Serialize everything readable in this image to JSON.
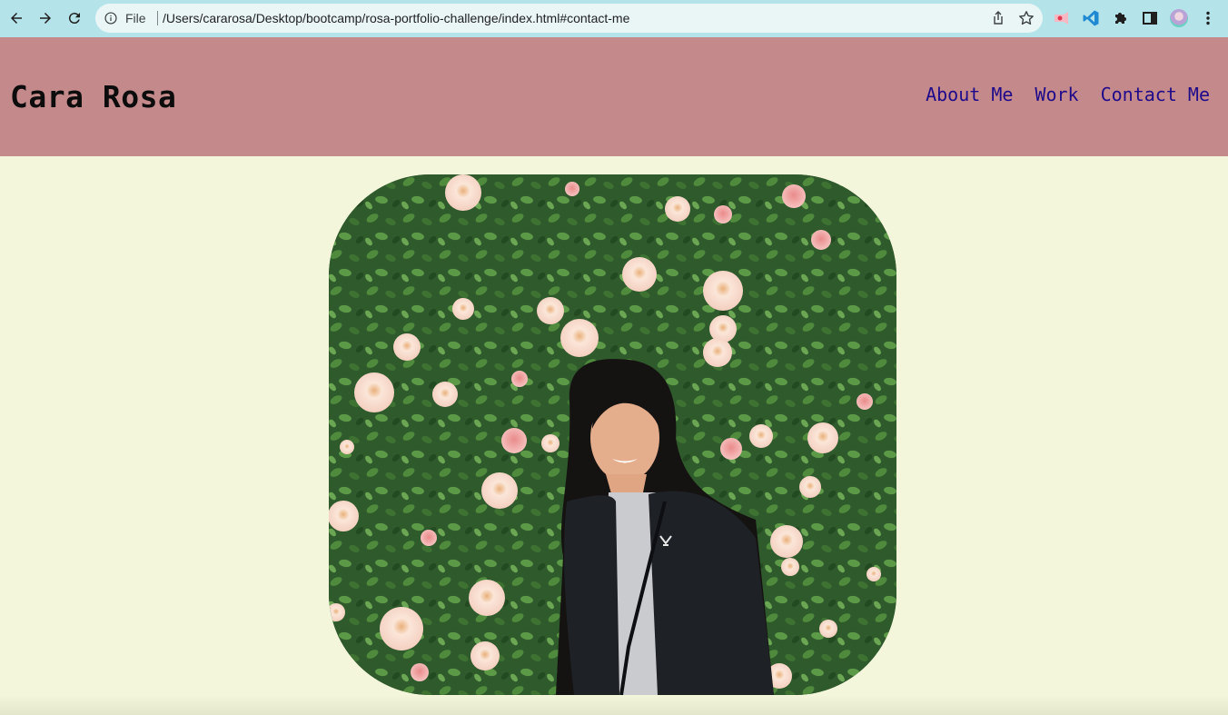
{
  "browser": {
    "file_label": "File",
    "url": "/Users/cararosa/Desktop/bootcamp/rosa-portfolio-challenge/index.html#contact-me"
  },
  "header": {
    "title": "Cara Rosa",
    "nav": [
      "About Me",
      "Work",
      "Contact Me"
    ]
  },
  "icons": {
    "back": "arrow-left-icon",
    "forward": "arrow-right-icon",
    "reload": "reload-icon",
    "info": "info-icon",
    "share": "share-icon",
    "bookmark": "star-icon",
    "extensions": [
      "screen-recorder-icon",
      "vscode-icon",
      "puzzle-icon"
    ],
    "side_panel": "side-panel-icon",
    "menu": "kebab-menu-icon"
  },
  "colors": {
    "chrome_bg": "#b4e3ea",
    "header_bg": "#c48a8b",
    "page_bg": "#f4f6dc",
    "nav_link": "#1f0a8a",
    "title": "#0c0c0c"
  }
}
